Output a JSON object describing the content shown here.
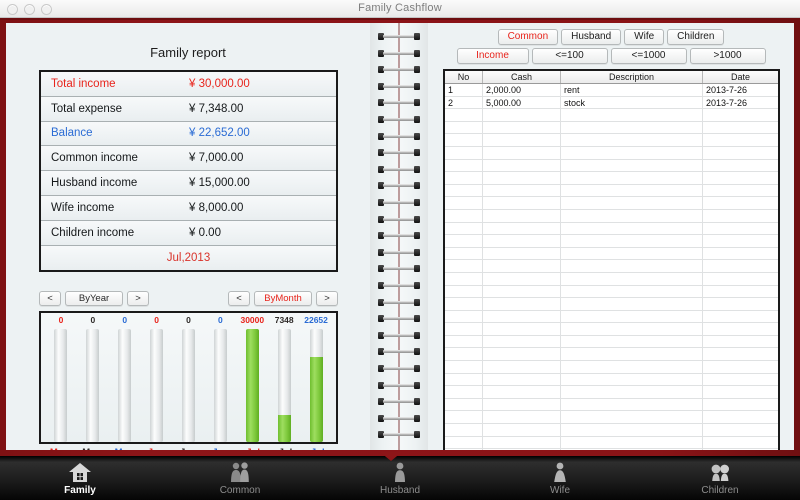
{
  "window": {
    "title": "Family Cashflow",
    "traffic_lights": [
      "close-button",
      "minimize-button",
      "zoom-button"
    ]
  },
  "left_page": {
    "report_title": "Family report",
    "report_rows": [
      {
        "label": "Total income",
        "value": "¥ 30,000.00",
        "color": "red"
      },
      {
        "label": "Total expense",
        "value": "¥ 7,348.00",
        "color": "dark"
      },
      {
        "label": "Balance",
        "value": "¥ 22,652.00",
        "color": "blue"
      },
      {
        "label": "Common income",
        "value": "¥ 7,000.00",
        "color": "dark"
      },
      {
        "label": "Husband income",
        "value": "¥ 15,000.00",
        "color": "dark"
      },
      {
        "label": "Wife income",
        "value": "¥ 8,000.00",
        "color": "dark"
      },
      {
        "label": "Children income",
        "value": "¥ 0.00",
        "color": "dark"
      }
    ],
    "period": "Jul,2013",
    "nav": {
      "year_prev": "<",
      "year_label": "ByYear",
      "year_next": ">",
      "month_prev": "<",
      "month_label": "ByMonth",
      "month_next": ">",
      "selected": "ByMonth"
    }
  },
  "right_page": {
    "category_buttons": [
      {
        "label": "Common",
        "selected": true
      },
      {
        "label": "Husband",
        "selected": false
      },
      {
        "label": "Wife",
        "selected": false
      },
      {
        "label": "Children",
        "selected": false
      }
    ],
    "filter_buttons": [
      {
        "label": "Income",
        "selected": true
      },
      {
        "label": "<=100",
        "selected": false
      },
      {
        "label": "<=1000",
        "selected": false
      },
      {
        "label": ">1000",
        "selected": false
      }
    ],
    "table": {
      "columns": [
        "No",
        "Cash",
        "Description",
        "Date"
      ],
      "rows": [
        {
          "no": "1",
          "cash": "2,000.00",
          "description": "rent",
          "date": "2013-7-26"
        },
        {
          "no": "2",
          "cash": "5,000.00",
          "description": "stock",
          "date": "2013-7-26"
        }
      ],
      "empty_row_count": 28
    }
  },
  "toolbar": {
    "items": [
      {
        "label": "Family",
        "icon": "house-icon",
        "active": true
      },
      {
        "label": "Common",
        "icon": "couple-icon",
        "active": false
      },
      {
        "label": "Husband",
        "icon": "man-icon",
        "active": false
      },
      {
        "label": "Wife",
        "icon": "woman-icon",
        "active": false
      },
      {
        "label": "Children",
        "icon": "children-icon",
        "active": false
      }
    ]
  },
  "colors": {
    "frame_red": "#8d1518",
    "income_red": "#e8241c",
    "balance_blue": "#2a6bd4",
    "bar_green": "#7ec93c",
    "page_bg": "#edf2f3"
  },
  "chart_data": {
    "type": "bar",
    "title": "",
    "xlabel": "",
    "ylabel": "",
    "categories": [
      "May",
      "May",
      "May",
      "Jun",
      "Jun",
      "Jun",
      "Jul",
      "Jul",
      "Jul"
    ],
    "series_kind": [
      "income",
      "expense",
      "balance",
      "income",
      "expense",
      "balance",
      "income",
      "expense",
      "balance"
    ],
    "values": [
      0,
      0,
      0,
      0,
      0,
      0,
      30000,
      7348,
      22652
    ],
    "value_labels": [
      "0",
      "0",
      "0",
      "0",
      "0",
      "0",
      "30000",
      "7348",
      "22652"
    ],
    "fill_percent": [
      0,
      0,
      0,
      0,
      0,
      0,
      100,
      24,
      75
    ],
    "label_colors": [
      "red",
      "dark",
      "blue",
      "red",
      "dark",
      "blue",
      "red",
      "dark",
      "blue"
    ],
    "ylim": [
      0,
      30000
    ],
    "grid": false,
    "legend": "none"
  }
}
